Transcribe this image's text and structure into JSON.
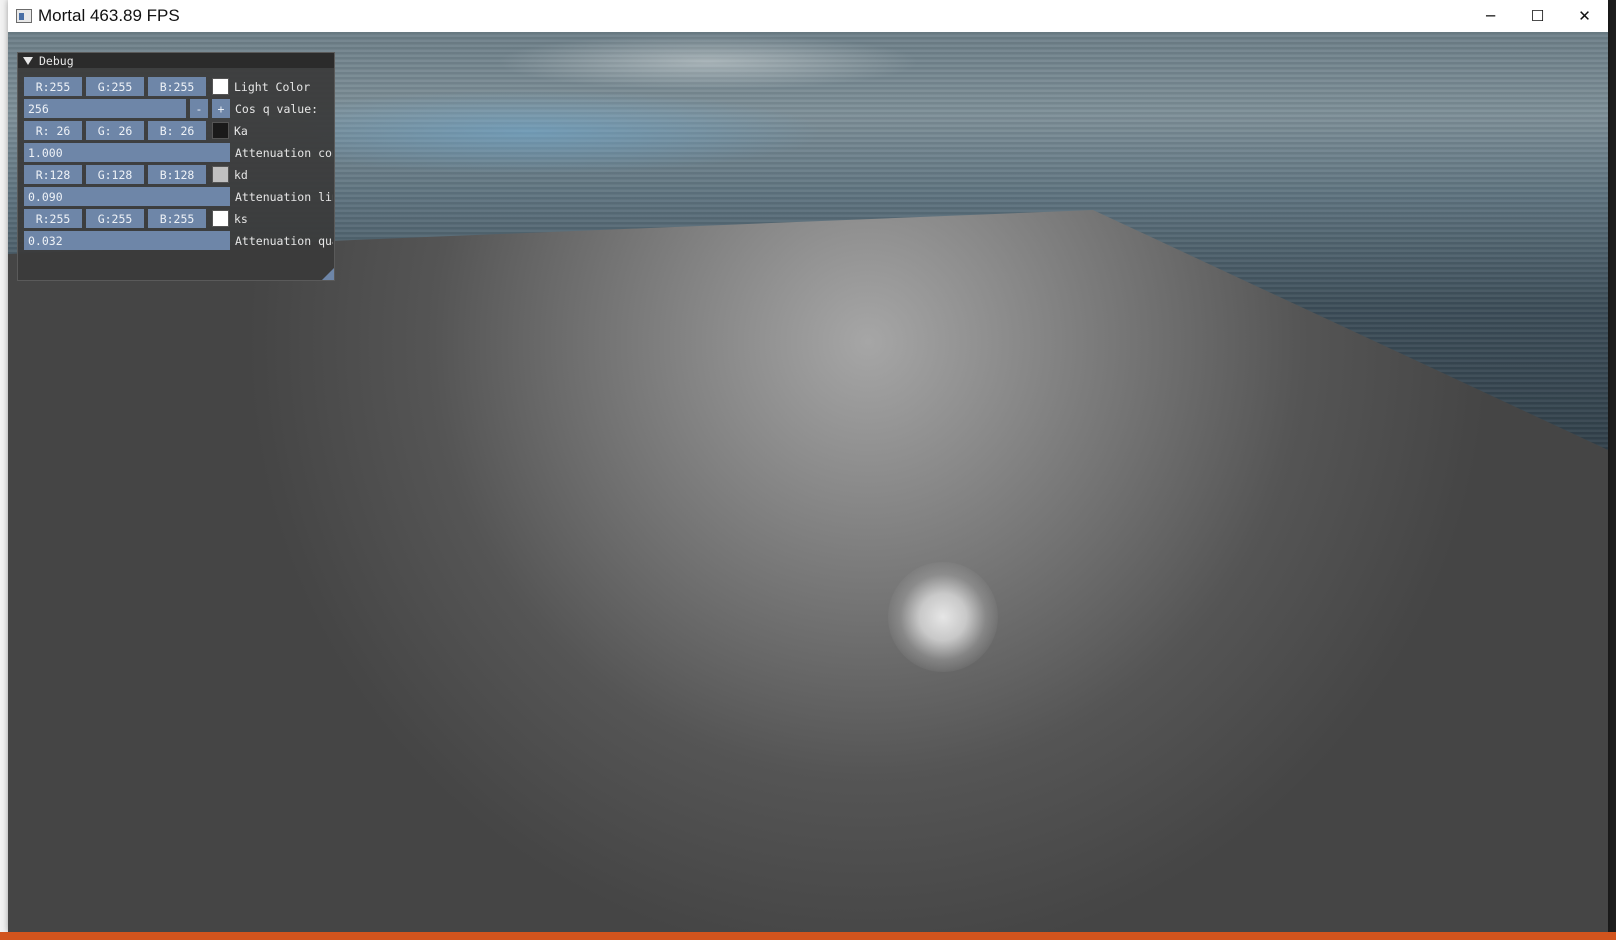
{
  "window": {
    "title": "Mortal 463.89 FPS",
    "controls": {
      "minimize_glyph": "─",
      "maximize_glyph": "☐",
      "close_glyph": "✕"
    }
  },
  "debug": {
    "header": "Debug",
    "light_color": {
      "r": "R:255",
      "g": "G:255",
      "b": "B:255",
      "swatch": "#ffffff",
      "label": "Light Color"
    },
    "cos_q": {
      "value": "256",
      "minus": "-",
      "plus": "+",
      "label": "Cos q value:"
    },
    "ka": {
      "r": "R: 26",
      "g": "G: 26",
      "b": "B: 26",
      "swatch": "#1a1a1a",
      "label": "Ka"
    },
    "attenuation_constant": {
      "value": "1.000",
      "label": "Attenuation constant"
    },
    "kd": {
      "r": "R:128",
      "g": "G:128",
      "b": "B:128",
      "swatch": "#c0c0c0",
      "label": "kd"
    },
    "attenuation_linear": {
      "value": "0.090",
      "label": "Attenuation linear"
    },
    "ks": {
      "r": "R:255",
      "g": "G:255",
      "b": "B:255",
      "swatch": "#ffffff",
      "label": "ks"
    },
    "attenuation_quadratic": {
      "value": "0.032",
      "label": "Attenuation quadratic"
    }
  },
  "colors": {
    "widget_bg": "#6e86a8",
    "panel_bg": "#3a3a3a",
    "taskbar_accent": "#d2541d"
  }
}
